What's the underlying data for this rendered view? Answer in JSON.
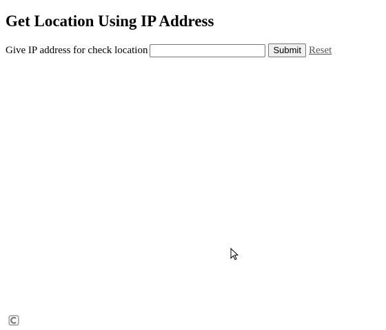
{
  "page": {
    "title": "Get Location Using IP Address"
  },
  "form": {
    "prompt": "Give IP address for check location",
    "ip_value": "",
    "ip_placeholder": "",
    "submit_label": "Submit",
    "reset_label": "Reset"
  },
  "icons": {
    "cursor": "mouse-pointer-icon",
    "corner": "c-logo-icon"
  }
}
